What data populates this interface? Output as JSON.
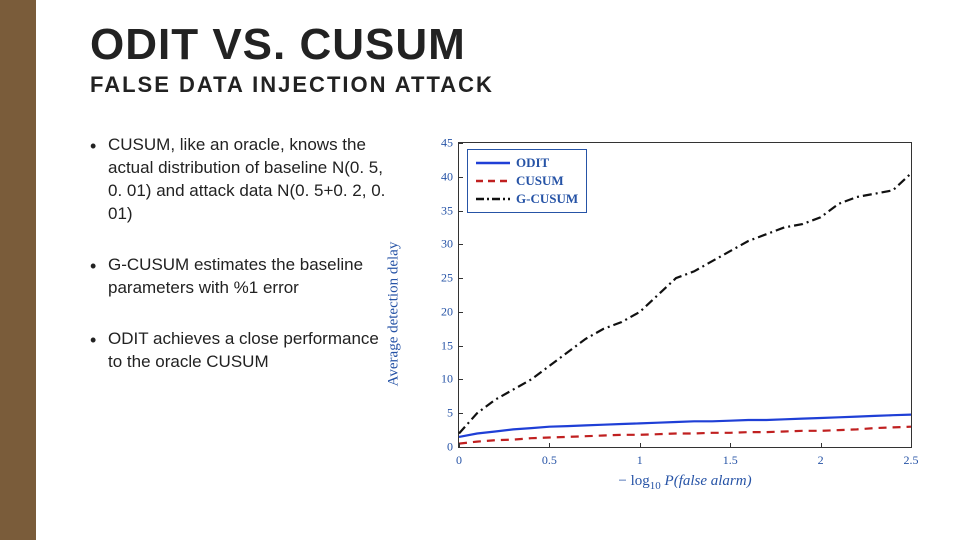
{
  "title": "ODIT VS. CUSUM",
  "subtitle": "FALSE DATA INJECTION ATTACK",
  "bullets": [
    "CUSUM, like an oracle, knows the actual distribution of baseline N(0. 5, 0. 01) and attack data N(0. 5+0. 2, 0. 01)",
    "G-CUSUM estimates the baseline parameters with %1 error",
    "ODIT achieves a close performance to the oracle CUSUM"
  ],
  "chart": {
    "ylabel": "Average detection delay",
    "xlabel_prefix": "− log",
    "xlabel_sub": "10",
    "xlabel_rest": " P(false alarm)",
    "legend": [
      "ODIT",
      "CUSUM",
      "G-CUSUM"
    ]
  },
  "chart_data": {
    "type": "line",
    "title": "",
    "xlabel": "− log10 P(false alarm)",
    "ylabel": "Average detection delay",
    "xlim": [
      0,
      2.5
    ],
    "ylim": [
      0,
      45
    ],
    "xticks": [
      0,
      0.5,
      1,
      1.5,
      2,
      2.5
    ],
    "yticks": [
      0,
      5,
      10,
      15,
      20,
      25,
      30,
      35,
      40,
      45
    ],
    "x": [
      0.0,
      0.1,
      0.2,
      0.3,
      0.4,
      0.5,
      0.6,
      0.7,
      0.8,
      0.9,
      1.0,
      1.1,
      1.2,
      1.3,
      1.4,
      1.5,
      1.6,
      1.7,
      1.8,
      1.9,
      2.0,
      2.1,
      2.2,
      2.3,
      2.4,
      2.5
    ],
    "series": [
      {
        "name": "ODIT",
        "style": "solid",
        "color": "#1f3fd6",
        "values": [
          1.5,
          2.0,
          2.3,
          2.6,
          2.8,
          3.0,
          3.1,
          3.2,
          3.3,
          3.4,
          3.5,
          3.6,
          3.7,
          3.8,
          3.8,
          3.9,
          4.0,
          4.0,
          4.1,
          4.2,
          4.3,
          4.4,
          4.5,
          4.6,
          4.7,
          4.8
        ]
      },
      {
        "name": "CUSUM",
        "style": "dash",
        "color": "#c02020",
        "values": [
          0.5,
          0.8,
          1.0,
          1.1,
          1.3,
          1.4,
          1.5,
          1.6,
          1.7,
          1.8,
          1.8,
          1.9,
          2.0,
          2.0,
          2.1,
          2.1,
          2.2,
          2.2,
          2.3,
          2.4,
          2.4,
          2.5,
          2.6,
          2.8,
          2.9,
          3.0
        ]
      },
      {
        "name": "G-CUSUM",
        "style": "dashdot",
        "color": "#111111",
        "values": [
          2.0,
          5.0,
          7.0,
          8.5,
          10.0,
          12.0,
          14.0,
          16.0,
          17.5,
          18.5,
          20.0,
          22.5,
          25.0,
          26.0,
          27.5,
          29.0,
          30.5,
          31.5,
          32.5,
          33.0,
          34.0,
          36.0,
          37.0,
          37.5,
          38.0,
          40.5
        ]
      }
    ]
  }
}
